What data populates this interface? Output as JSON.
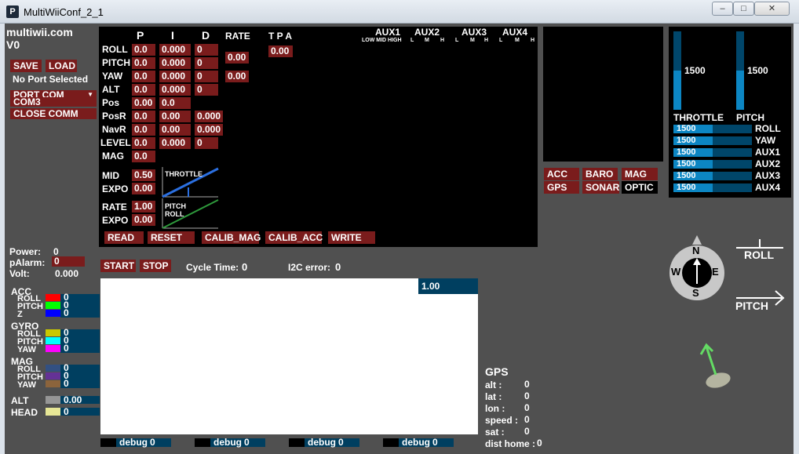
{
  "window": {
    "title": "MultiWiiConf_2_1",
    "min": "‒",
    "max": "□",
    "close": "✕"
  },
  "brand": {
    "name": "multiwii.com",
    "version": "V0"
  },
  "file": {
    "save": "SAVE",
    "load": "LOAD",
    "port_status": "No Port Selected",
    "port_com": "PORT COM",
    "com3": "COM3",
    "close_comm": "CLOSE COMM"
  },
  "pid": {
    "headers": {
      "p": "P",
      "i": "I",
      "d": "D",
      "rate": "RATE",
      "tpa": "T P A"
    },
    "rows": [
      {
        "name": "ROLL",
        "p": "0.0",
        "i": "0.000",
        "d": "0"
      },
      {
        "name": "PITCH",
        "p": "0.0",
        "i": "0.000",
        "d": "0"
      },
      {
        "name": "YAW",
        "p": "0.0",
        "i": "0.000",
        "d": "0"
      },
      {
        "name": "ALT",
        "p": "0.0",
        "i": "0.000",
        "d": "0"
      },
      {
        "name": "Pos",
        "p": "0.00",
        "i": "0.0"
      },
      {
        "name": "PosR",
        "p": "0.0",
        "i": "0.00",
        "d": "0.000"
      },
      {
        "name": "NavR",
        "p": "0.0",
        "i": "0.00",
        "d": "0.000"
      },
      {
        "name": "LEVEL",
        "p": "0.0",
        "i": "0.000",
        "d": "0"
      },
      {
        "name": "MAG",
        "p": "0.0"
      }
    ],
    "rate_roll_pitch": "0.00",
    "rate_yaw": "0.00",
    "tpa": "0.00",
    "throttle": {
      "mid_label": "MID",
      "mid": "0.50",
      "expo_label": "EXPO",
      "expo": "0.00",
      "curve_label": "THROTTLE"
    },
    "rc": {
      "rate_label": "RATE",
      "rate": "1.00",
      "expo_label": "EXPO",
      "expo": "0.00",
      "curve_label_1": "PITCH",
      "curve_label_2": "ROLL"
    },
    "actions": {
      "read": "READ",
      "reset": "RESET",
      "calib_mag": "CALIB_MAG",
      "calib_acc": "CALIB_ACC",
      "write": "WRITE"
    }
  },
  "aux": {
    "groups": [
      "AUX1",
      "AUX2",
      "AUX3",
      "AUX4"
    ],
    "aux1_sub": "LOW MID HIGH",
    "sub": [
      "L",
      "M",
      "H"
    ]
  },
  "sensors": {
    "acc": "ACC",
    "baro": "BARO",
    "mag": "MAG",
    "gps": "GPS",
    "sonar": "SONAR",
    "optic": "OPTIC"
  },
  "rc_channels": {
    "throttle": {
      "label": "THROTTLE",
      "value": "1500",
      "level": 0.5
    },
    "pitch": {
      "label": "PITCH",
      "value": "1500",
      "level": 0.5
    },
    "bars": [
      {
        "label": "ROLL",
        "value": "1500",
        "level": 0.5
      },
      {
        "label": "YAW",
        "value": "1500",
        "level": 0.5
      },
      {
        "label": "AUX1",
        "value": "1500",
        "level": 0.5
      },
      {
        "label": "AUX2",
        "value": "1500",
        "level": 0.5
      },
      {
        "label": "AUX3",
        "value": "1500",
        "level": 0.5
      },
      {
        "label": "AUX4",
        "value": "1500",
        "level": 0.5
      }
    ]
  },
  "power": {
    "power_label": "Power:",
    "power": "0",
    "palarm_label": "pAlarm:",
    "palarm": "0",
    "volt_label": "Volt:",
    "volt": "0.000"
  },
  "controls": {
    "start": "START",
    "stop": "STOP",
    "cycle_label": "Cycle Time:",
    "cycle": "0",
    "i2c_label": "I2C error:",
    "i2c": "0"
  },
  "graph": {
    "scale": "1.00"
  },
  "live": {
    "acc": {
      "label": "ACC",
      "roll": "ROLL",
      "pitch": "PITCH",
      "z": "Z",
      "roll_v": "0",
      "pitch_v": "0",
      "z_v": "0"
    },
    "gyro": {
      "label": "GYRO",
      "roll": "ROLL",
      "pitch": "PITCH",
      "yaw": "YAW",
      "roll_v": "0",
      "pitch_v": "0",
      "yaw_v": "0"
    },
    "mag": {
      "label": "MAG",
      "roll": "ROLL",
      "pitch": "PITCH",
      "yaw": "YAW",
      "roll_v": "0",
      "pitch_v": "0",
      "yaw_v": "0"
    },
    "alt": {
      "label": "ALT",
      "value": "0.00"
    },
    "head": {
      "label": "HEAD",
      "value": "0"
    }
  },
  "colors": {
    "acc_roll": "#ff0000",
    "acc_pitch": "#00ff00",
    "acc_z": "#0000ff",
    "gyro_roll": "#c8c800",
    "gyro_pitch": "#00ffff",
    "gyro_yaw": "#ff00ff",
    "mag_roll": "#325082",
    "mag_pitch": "#643296",
    "mag_yaw": "#8c643c",
    "alt": "#969696",
    "head": "#e6e696"
  },
  "debug": [
    {
      "label": "debug",
      "value": "0"
    },
    {
      "label": "debug",
      "value": "0"
    },
    {
      "label": "debug",
      "value": "0"
    },
    {
      "label": "debug",
      "value": "0"
    }
  ],
  "gps": {
    "title": "GPS",
    "rows": [
      {
        "label": "alt   :",
        "value": "0"
      },
      {
        "label": "lat   :",
        "value": "0"
      },
      {
        "label": "lon   :",
        "value": "0"
      },
      {
        "label": "speed :",
        "value": "0"
      },
      {
        "label": "sat   :",
        "value": "0"
      },
      {
        "label": "dist home :",
        "value": "0"
      }
    ]
  },
  "compass": {
    "n": "N",
    "s": "S",
    "e": "E",
    "w": "W"
  },
  "attitude": {
    "roll": "ROLL",
    "pitch": "PITCH"
  }
}
